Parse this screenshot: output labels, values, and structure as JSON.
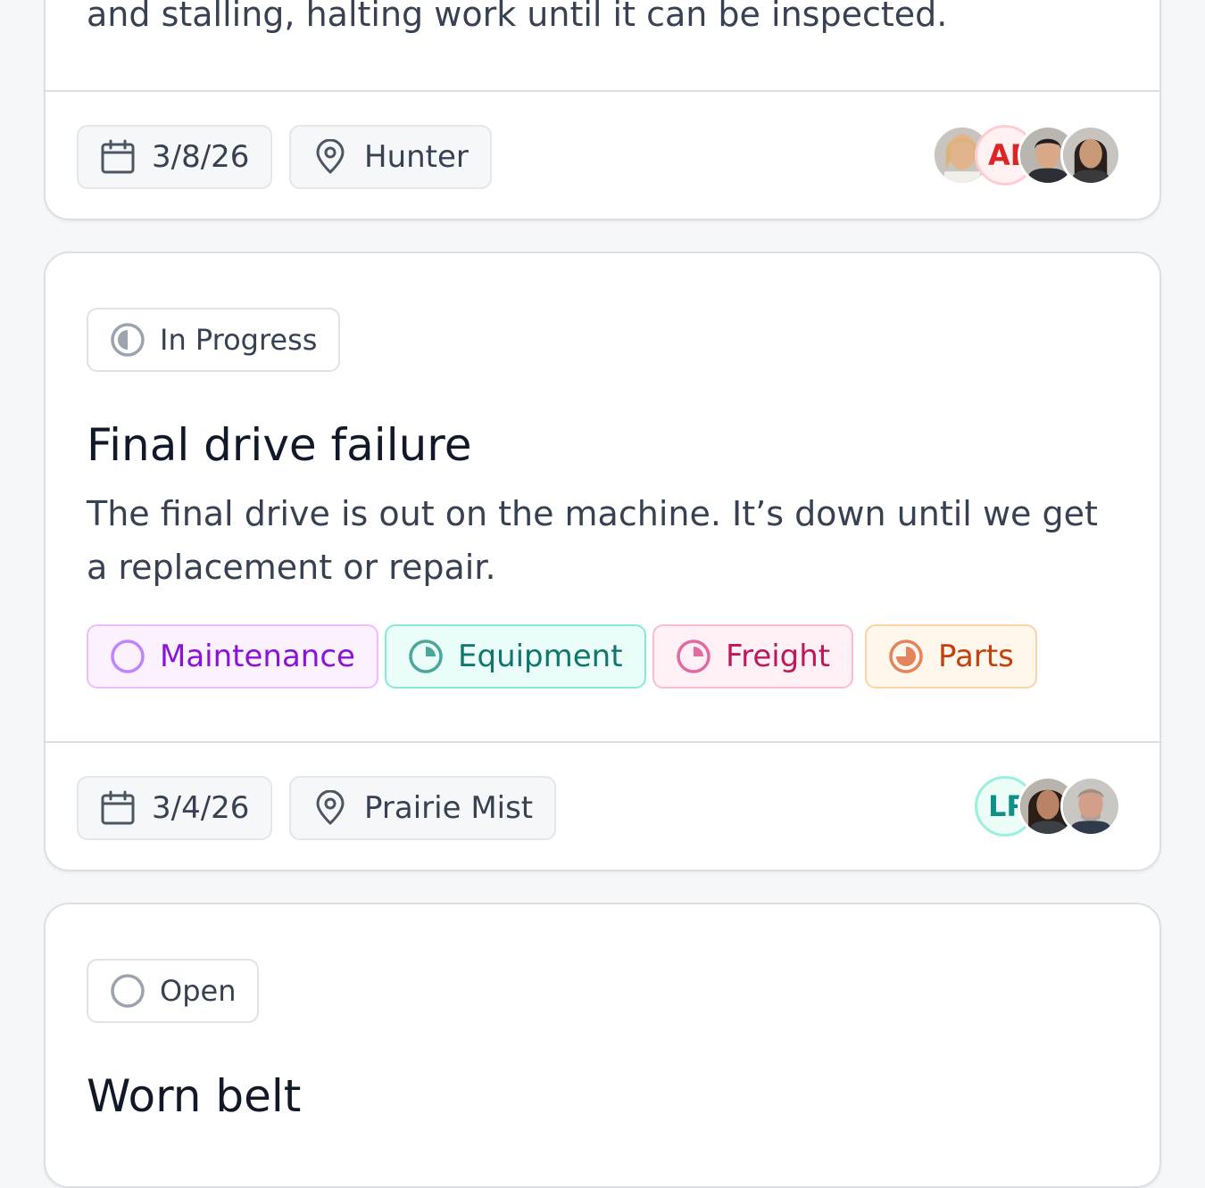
{
  "cards": [
    {
      "description_tail": "and stalling, halting work until it can be inspected.",
      "date": "3/8/26",
      "location": "Hunter",
      "assignees": [
        {
          "type": "photo",
          "name": "assignee-photo"
        },
        {
          "type": "initials",
          "initials": "AE",
          "color": "#dc2626",
          "bg": "#fff1f2",
          "border": "#fecdd3"
        },
        {
          "type": "photo",
          "name": "assignee-photo"
        },
        {
          "type": "photo",
          "name": "assignee-photo"
        }
      ]
    },
    {
      "status": "In Progress",
      "title": "Final drive failure",
      "description": "The final drive is out on the machine. It’s down until we get a replacement or repair.",
      "tags": [
        {
          "label": "Maintenance",
          "color": "#8b12d9",
          "bg": "#fbf1ff",
          "border": "#eebcff",
          "icon": "circle-empty-icon"
        },
        {
          "label": "Equipment",
          "color": "#0f766e",
          "bg": "#ebfdf8",
          "border": "#86ead7",
          "icon": "circle-quarter-icon"
        },
        {
          "label": "Freight",
          "color": "#be185d",
          "bg": "#fff0f6",
          "border": "#f8bcd5",
          "icon": "circle-quarter-icon"
        },
        {
          "label": "Parts",
          "color": "#c2410c",
          "bg": "#fff6ec",
          "border": "#fdd2a7",
          "icon": "circle-three-quarter-icon"
        }
      ],
      "date": "3/4/26",
      "location": "Prairie Mist",
      "assignees": [
        {
          "type": "initials",
          "initials": "LR",
          "color": "#0f8f85",
          "bg": "#ecfdf8",
          "border": "#99f0dd"
        },
        {
          "type": "photo",
          "name": "assignee-photo"
        },
        {
          "type": "photo",
          "name": "assignee-photo"
        }
      ]
    },
    {
      "status": "Open",
      "title": "Worn belt"
    }
  ]
}
